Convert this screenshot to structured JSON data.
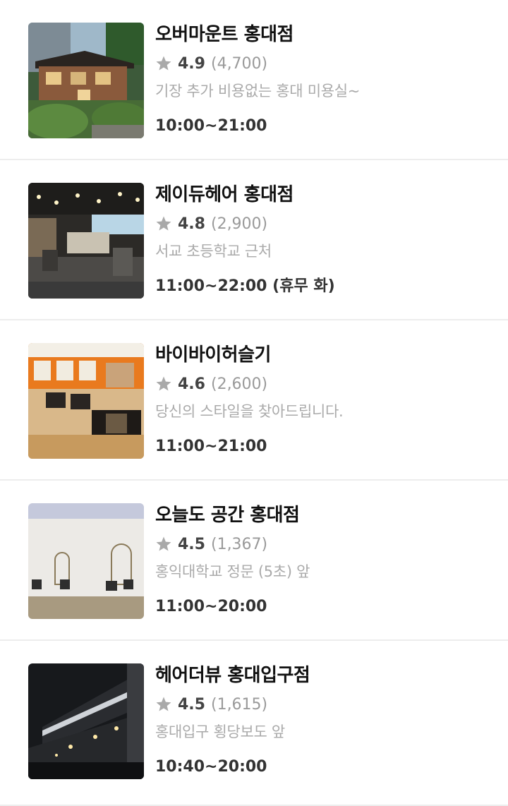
{
  "shops": [
    {
      "name": "오버마운트 홍대점",
      "rating": "4.9",
      "review_count": "(4,700)",
      "description": "기장 추가 비용없는 홍대 미용실~",
      "hours": "10:00~21:00",
      "thumbnail": "building-exterior-photo"
    },
    {
      "name": "제이듀헤어 홍대점",
      "rating": "4.8",
      "review_count": "(2,900)",
      "description": "서교 초등학교 근처",
      "hours": "11:00~22:00 (휴무 화)",
      "thumbnail": "salon-interior-photo"
    },
    {
      "name": "바이바이허슬기",
      "rating": "4.6",
      "review_count": "(2,600)",
      "description": "당신의 스타일을 찾아드립니다.",
      "hours": "11:00~21:00",
      "thumbnail": "orange-salon-interior-photo"
    },
    {
      "name": "오늘도 공간 홍대점",
      "rating": "4.5",
      "review_count": "(1,367)",
      "description": "홍익대학교 정문 (5초) 앞",
      "hours": "11:00~20:00",
      "thumbnail": "white-salon-interior-photo"
    },
    {
      "name": "헤어더뷰 홍대입구점",
      "rating": "4.5",
      "review_count": "(1,615)",
      "description": "홍대입구 횡당보도 앞",
      "hours": "10:40~20:00",
      "thumbnail": "night-storefront-photo"
    }
  ],
  "colors": {
    "star": "#a9a9a9",
    "divider": "#ededed",
    "description": "#aaaaaa"
  }
}
